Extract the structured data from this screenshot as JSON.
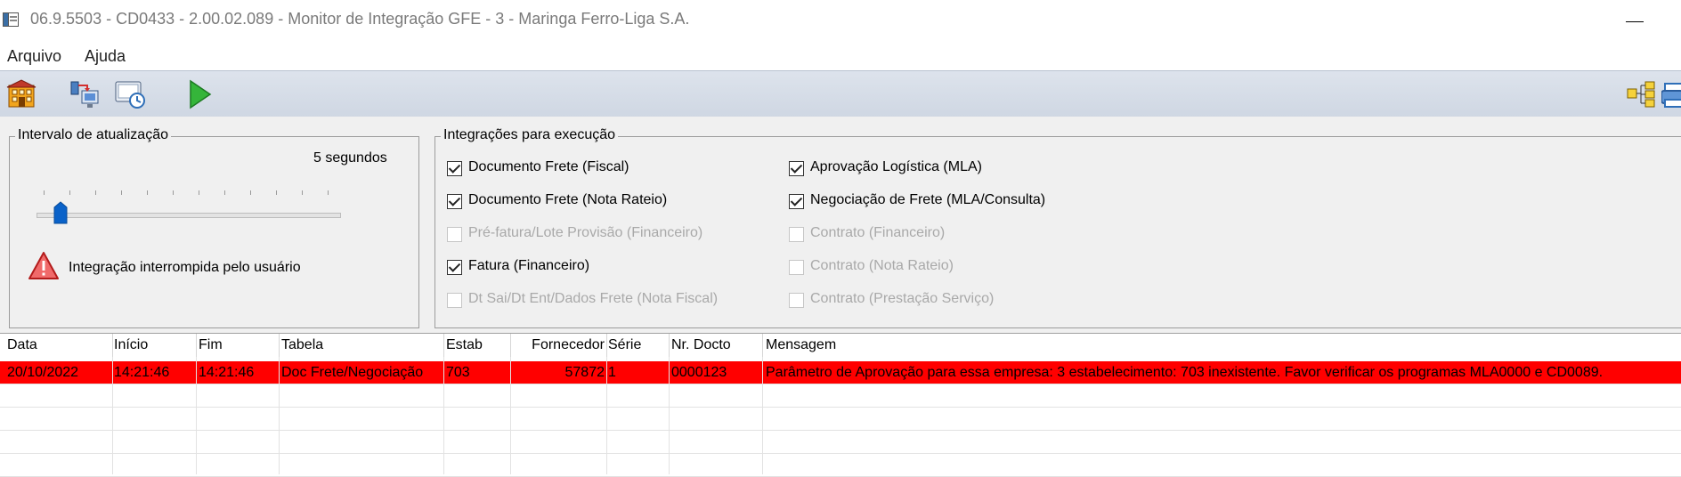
{
  "window": {
    "title": "06.9.5503 - CD0433 - 2.00.02.089 - Monitor de Integração GFE - 3 - Maringa Ferro-Liga S.A."
  },
  "menu": {
    "items": [
      "Arquivo",
      "Ajuda"
    ]
  },
  "toolbar": {
    "icons": [
      "building-icon",
      "network-transfer-icon",
      "monitor-clock-icon",
      "play-icon",
      "tree-structure-icon",
      "printer-icon"
    ]
  },
  "interval": {
    "title": "Intervalo de atualização",
    "value_label": "5 segundos",
    "slider_fraction": 0.08,
    "status_text": "Integração interrompida pelo usuário"
  },
  "integrations": {
    "title": "Integrações para execução",
    "options": [
      {
        "label": "Documento Frete (Fiscal)",
        "checked": true,
        "enabled": true
      },
      {
        "label": "Documento Frete (Nota Rateio)",
        "checked": true,
        "enabled": true
      },
      {
        "label": "Pré-fatura/Lote Provisão (Financeiro)",
        "checked": false,
        "enabled": false
      },
      {
        "label": "Fatura (Financeiro)",
        "checked": true,
        "enabled": true
      },
      {
        "label": "Dt Sai/Dt Ent/Dados Frete (Nota Fiscal)",
        "checked": false,
        "enabled": false
      },
      {
        "label": "Aprovação Logística (MLA)",
        "checked": true,
        "enabled": true
      },
      {
        "label": "Negociação de Frete (MLA/Consulta)",
        "checked": true,
        "enabled": true
      },
      {
        "label": "Contrato (Financeiro)",
        "checked": false,
        "enabled": false
      },
      {
        "label": "Contrato (Nota Rateio)",
        "checked": false,
        "enabled": false
      },
      {
        "label": "Contrato (Prestação Serviço)",
        "checked": false,
        "enabled": false
      }
    ]
  },
  "grid": {
    "columns": [
      "Data",
      "Início",
      "Fim",
      "Tabela",
      "Estab",
      "Fornecedor",
      "Série",
      "Nr. Docto",
      "Mensagem"
    ],
    "rows": [
      [
        "20/10/2022",
        "14:21:46",
        "14:21:46",
        "Doc Frete/Negociação",
        "703",
        "57872",
        "1",
        "0000123",
        "Parâmetro de Aprovação para essa empresa: 3 estabelecimento: 703 inexistente. Favor verificar os programas MLA0000 e CD0089."
      ]
    ],
    "selected_row_color": "#ff0000"
  }
}
